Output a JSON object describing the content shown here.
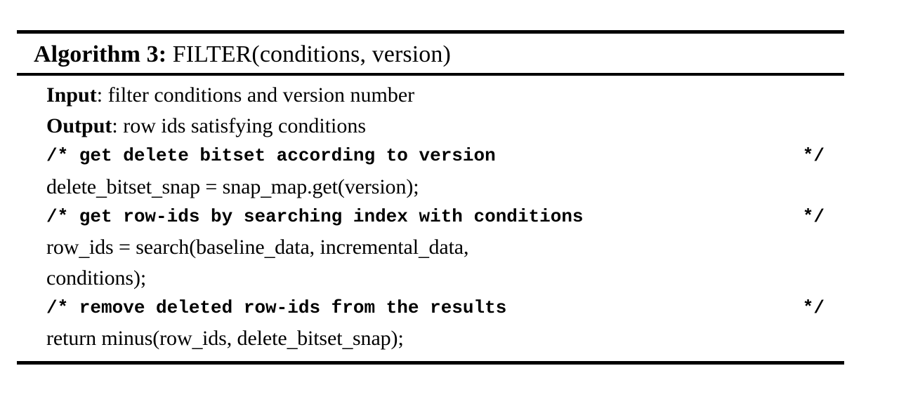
{
  "algorithm": {
    "label": "Algorithm 3:",
    "signature": "FILTER(conditions, version)",
    "io": [
      {
        "keyword": "Input",
        "separator": ": ",
        "text": "filter conditions and version number"
      },
      {
        "keyword": "Output",
        "separator": ": ",
        "text": "row ids satisfying conditions"
      }
    ],
    "lines": [
      {
        "kind": "comment",
        "text": "/* get delete bitset according to version",
        "close": "*/"
      },
      {
        "kind": "code",
        "text": "delete_bitset_snap = snap_map.get(version);"
      },
      {
        "kind": "comment",
        "text": "/* get row-ids by searching index with conditions",
        "close": "*/"
      },
      {
        "kind": "code",
        "text": "row_ids = search(baseline_data, incremental_data,"
      },
      {
        "kind": "code",
        "text": "conditions);"
      },
      {
        "kind": "comment",
        "text": "/* remove deleted row-ids from the results",
        "close": "*/"
      },
      {
        "kind": "code",
        "text": "return minus(row_ids, delete_bitset_snap);"
      }
    ],
    "colors": {
      "ink": "#000000",
      "page": "#ffffff"
    }
  }
}
